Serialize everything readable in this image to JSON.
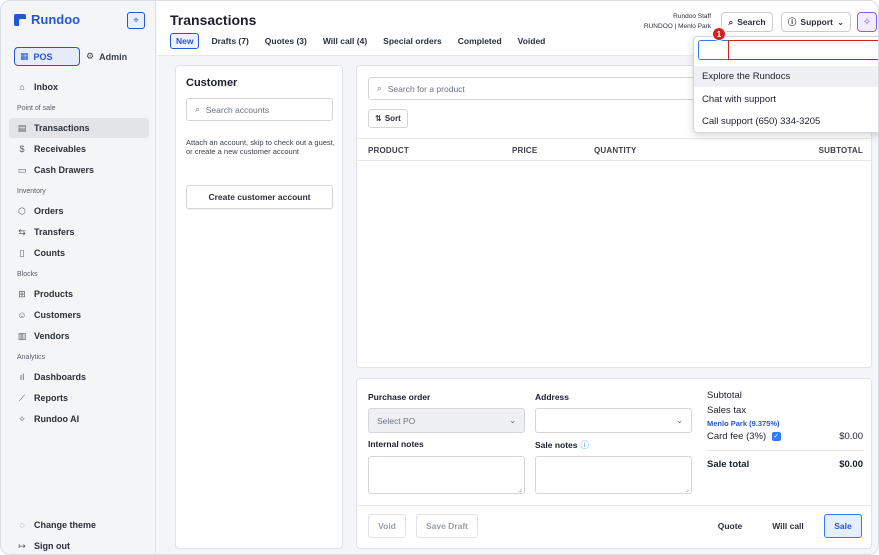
{
  "brand": {
    "name": "Rundoo"
  },
  "mode": {
    "pos_label": "POS",
    "admin_label": "Admin"
  },
  "sidebar": {
    "inbox": "Inbox",
    "sections": {
      "point_of_sale": "Point of sale",
      "inventory": "Inventory",
      "blocks": "Blocks",
      "analytics": "Analytics"
    },
    "items": {
      "transactions": "Transactions",
      "receivables": "Receivables",
      "cash_drawers": "Cash Drawers",
      "orders": "Orders",
      "transfers": "Transfers",
      "counts": "Counts",
      "products": "Products",
      "customers": "Customers",
      "vendors": "Vendors",
      "dashboards": "Dashboards",
      "reports": "Reports",
      "rundoo_ai": "Rundoo AI"
    },
    "bottom": {
      "change_theme": "Change theme",
      "sign_out": "Sign out"
    }
  },
  "header": {
    "title": "Transactions",
    "tabs": [
      "New",
      "Drafts (7)",
      "Quotes (3)",
      "Will call (4)",
      "Special orders",
      "Completed",
      "Voided"
    ],
    "staff_name": "Rundoo Staff",
    "staff_location": "RUNDOO | Menlo Park",
    "search_label": "Search",
    "support_label": "Support"
  },
  "customer": {
    "title": "Customer",
    "search_placeholder": "Search accounts",
    "help_text": "Attach an account, skip to check out a guest, or create a new customer account",
    "create_label": "Create customer account"
  },
  "products": {
    "search_placeholder": "Search for a product",
    "sort_label": "Sort",
    "columns": [
      "PRODUCT",
      "PRICE",
      "QUANTITY",
      "SUBTOTAL"
    ]
  },
  "order": {
    "purchase_order_label": "Purchase order",
    "po_placeholder": "Select PO",
    "address_label": "Address",
    "internal_notes_label": "Internal notes",
    "sale_notes_label": "Sale notes",
    "subtotal_label": "Subtotal",
    "sales_tax_label": "Sales tax",
    "tax_location": "Menlo Park (9.375%)",
    "card_fee_label": "Card fee (3%)",
    "card_fee_value": "$0.00",
    "sale_total_label": "Sale total",
    "sale_total_value": "$0.00"
  },
  "actions": {
    "void": "Void",
    "save_draft": "Save Draft",
    "quote": "Quote",
    "will_call": "Will call",
    "sale": "Sale"
  },
  "support_menu": {
    "items": [
      "Explore the Rundocs",
      "Chat with support",
      "Call support (650) 334-3205"
    ],
    "badge": "1"
  },
  "colors": {
    "accent": "#2456d6",
    "ai_accent": "#8a5cf5",
    "alert": "#d52020",
    "checkbox": "#2e7cf6"
  }
}
